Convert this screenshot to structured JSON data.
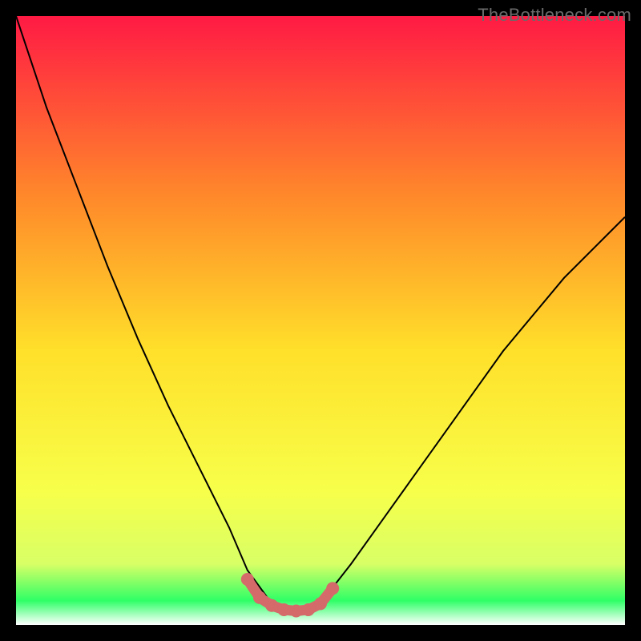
{
  "watermark": "TheBottleneck.com",
  "colors": {
    "frame": "#000000",
    "curve": "#000000",
    "marker_fill": "#d46a6a",
    "marker_stroke": "#d46a6a",
    "gradient_top": "#ff1a44",
    "gradient_mid_upper": "#ff8a2a",
    "gradient_mid": "#ffe02a",
    "gradient_mid_lower": "#f7ff4a",
    "gradient_near_bottom": "#d8ff66",
    "gradient_green": "#2fff66",
    "gradient_white": "#ffffff"
  },
  "chart_data": {
    "type": "line",
    "title": "",
    "xlabel": "",
    "ylabel": "",
    "xlim": [
      0,
      100
    ],
    "ylim": [
      0,
      100
    ],
    "note": "Axes are unlabeled in the source image; values are normalized 0–100 estimates read from pixel positions. y is distance from the bottom baseline (0 = bottom).",
    "series": [
      {
        "name": "curve",
        "x": [
          0,
          5,
          10,
          15,
          20,
          25,
          30,
          35,
          38,
          42,
          44,
          46,
          48,
          50,
          55,
          60,
          65,
          70,
          75,
          80,
          85,
          90,
          95,
          100
        ],
        "values": [
          100,
          85,
          72,
          59,
          47,
          36,
          26,
          16,
          9,
          3.5,
          2.5,
          2.2,
          2.5,
          3.6,
          10,
          17,
          24,
          31,
          38,
          45,
          51,
          57,
          62,
          67
        ]
      }
    ],
    "markers": {
      "name": "highlighted-points",
      "x": [
        38,
        40,
        42,
        44,
        46,
        48,
        50,
        52
      ],
      "values": [
        7.5,
        4.5,
        3.2,
        2.5,
        2.3,
        2.5,
        3.5,
        6.0
      ]
    }
  }
}
